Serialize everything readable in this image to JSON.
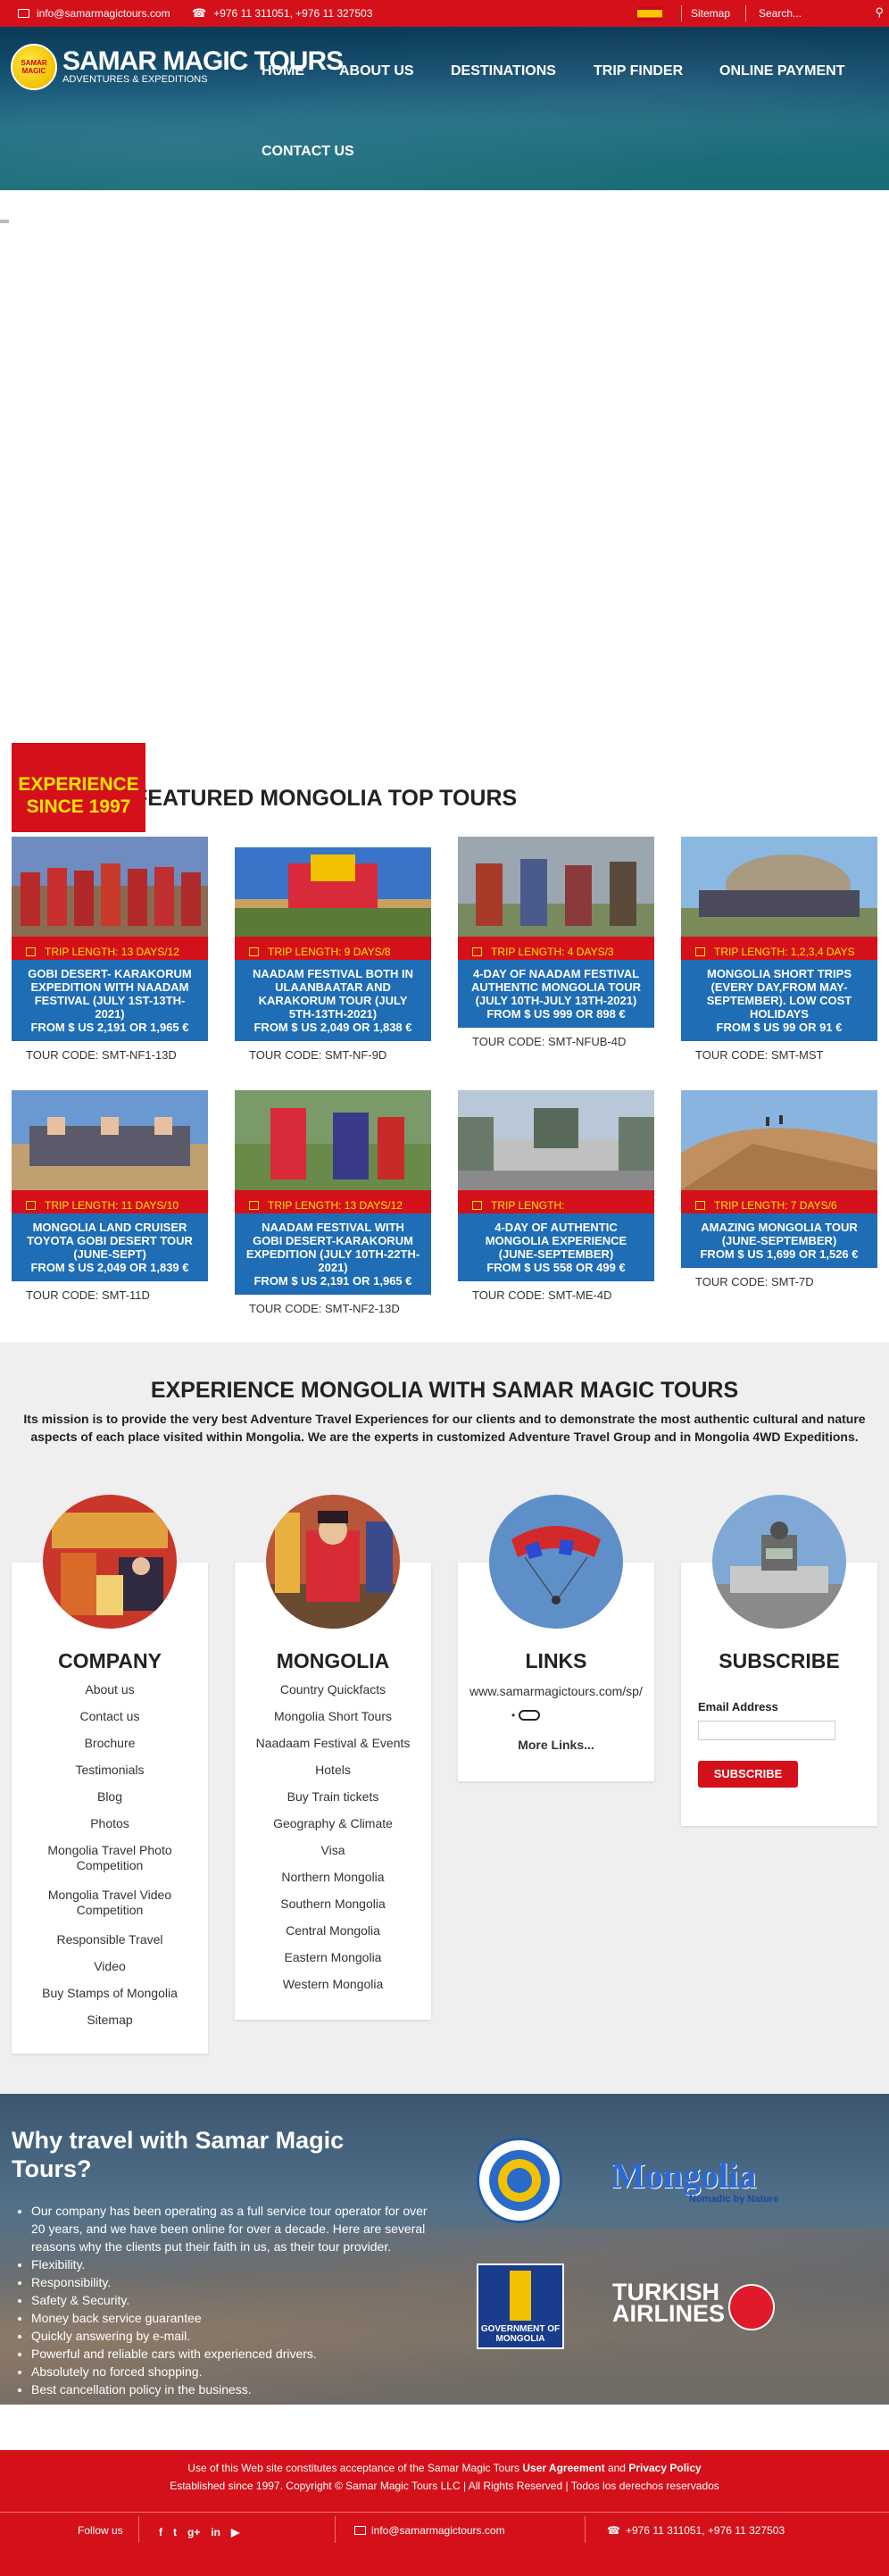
{
  "topbar": {
    "email": "info@samarmagictours.com",
    "phone": "+976 11 311051, +976 11 327503",
    "sitemap": "Sitemap",
    "search_placeholder": "Search..."
  },
  "logo": {
    "title": "SAMAR MAGIC TOURS",
    "subtitle": "ADVENTURES & EXPEDITIONS",
    "badge": "SAMAR MAGIC"
  },
  "nav": {
    "home": "HOME",
    "about": "ABOUT US",
    "destinations": "DESTINATIONS",
    "trip_finder": "TRIP FINDER",
    "payment": "ONLINE PAYMENT",
    "contact": "CONTACT US"
  },
  "badge": {
    "line1": "EXPERIENCE",
    "line2": "SINCE 1997"
  },
  "featured": {
    "title": "FEATURED MONGOLIA TOP TOURS"
  },
  "tours": [
    {
      "length": "TRIP LENGTH: 13 DAYS/12",
      "name": "GOBI DESERT- KARAKORUM EXPEDITION WITH NAADAM FESTIVAL (JULY 1ST-13TH-2021)",
      "price": "FROM $ US 2,191 OR 1,965 €",
      "code": "TOUR CODE: SMT-NF1-13D"
    },
    {
      "length": "TRIP LENGTH: 9 DAYS/8",
      "name": "NAADAM FESTIVAL BOTH IN ULAANBAATAR AND KARAKORUM TOUR (JULY 5TH-13TH-2021)",
      "price": "FROM $ US 2,049 OR 1,838 €",
      "code": "TOUR CODE: SMT-NF-9D"
    },
    {
      "length": "TRIP LENGTH: 4 DAYS/3",
      "name": "4-DAY OF NAADAM FESTIVAL AUTHENTIC MONGOLIA TOUR (JULY 10TH-JULY 13TH-2021)",
      "price": "FROM $ US 999 OR 898 €",
      "code": "TOUR CODE: SMT-NFUB-4D"
    },
    {
      "length": "TRIP LENGTH: 1,2,3,4 DAYS",
      "name": "MONGOLIA SHORT TRIPS (EVERY DAY,FROM MAY-SEPTEMBER). LOW COST HOLIDAYS",
      "price": "FROM $ US 99 OR 91 €",
      "code": "TOUR CODE: SMT-MST"
    },
    {
      "length": "TRIP LENGTH: 11 DAYS/10",
      "name": "MONGOLIA LAND CRUISER TOYOTA GOBI DESERT TOUR (JUNE-SEPT)",
      "price": "FROM $ US 2,049 OR 1,839 €",
      "code": "TOUR CODE: SMT-11D"
    },
    {
      "length": "TRIP LENGTH: 13 DAYS/12",
      "name": "NAADAM FESTIVAL WITH GOBI DESERT-KARAKORUM EXPEDITION (JULY 10TH-22TH-2021)",
      "price": "FROM $ US 2,191 OR 1,965 €",
      "code": "TOUR CODE: SMT-NF2-13D"
    },
    {
      "length": "TRIP LENGTH:",
      "name": "4-DAY OF AUTHENTIC MONGOLIA EXPERIENCE (JUNE-SEPTEMBER)",
      "price": "FROM $ US 558 OR 499 €",
      "code": "TOUR CODE: SMT-ME-4D"
    },
    {
      "length": "TRIP LENGTH: 7 DAYS/6",
      "name": "AMAZING MONGOLIA TOUR (JUNE-SEPTEMBER)",
      "price": "FROM $ US 1,699 OR 1,526 €",
      "code": "TOUR CODE: SMT-7D"
    }
  ],
  "about": {
    "title": "EXPERIENCE MONGOLIA WITH SAMAR MAGIC TOURS",
    "text": "Its mission is to provide the very best Adventure Travel Experiences for our clients and to demonstrate the most authentic cultural and nature aspects of each place visited within Mongolia. We are the experts in customized Adventure Travel Group and in Mongolia 4WD Expeditions."
  },
  "company": {
    "title": "COMPANY",
    "links": [
      "About us",
      "Contact us",
      "Brochure",
      "Testimonials",
      "Blog",
      "Photos",
      "Mongolia Travel Photo Competition",
      "Mongolia Travel Video Competition",
      "Responsible Travel",
      "Video",
      "Buy Stamps of Mongolia",
      "Sitemap"
    ]
  },
  "mongolia": {
    "title": "MONGOLIA",
    "links": [
      "Country Quickfacts",
      "Mongolia Short Tours",
      "Naadaam Festival & Events",
      "Hotels",
      "Buy Train tickets",
      "Geography & Climate",
      "Visa",
      "Northern Mongolia",
      "Southern Mongolia",
      "Central Mongolia",
      "Eastern Mongolia",
      "Western Mongolia"
    ]
  },
  "links": {
    "title": "LINKS",
    "url": "www.samarmagictours.com/sp/",
    "more": "More Links..."
  },
  "subscribe": {
    "title": "SUBSCRIBE",
    "email_label": "Email Address",
    "button": "SUBSCRIBE"
  },
  "why": {
    "title": "Why travel with Samar Magic Tours?",
    "items": [
      "Our company has been operating as a full service tour operator for over 20 years, and we have been online for over a decade. Here are several reasons why the clients put their faith in us, as their tour provider.",
      "Flexibility.",
      "Responsibility.",
      "Safety & Security.",
      "Money back service guarantee",
      "Quickly answering by e-mail.",
      "Powerful and reliable cars with experienced drivers.",
      "Absolutely no forced shopping.",
      "Best cancellation policy in the business."
    ],
    "logo_mongolia": "Mongolia",
    "logo_mongolia_sub": "Nomadic by Nature",
    "logo_gov": "GOVERNMENT OF MONGOLIA",
    "logo_turkish": "TURKISH AIRLINES"
  },
  "footer": {
    "terms_prefix": "Use of this Web site constitutes acceptance of the Samar Magic Tours ",
    "terms_link1": "User Agreement",
    "terms_and": " and ",
    "terms_link2": "Privacy Policy",
    "copyright": "Established since 1997. Copyright © Samar Magic Tours LLC | All Rights Reserved | Todos los derechos reservados",
    "follow": "Follow us",
    "social": [
      "f",
      "t",
      "g+",
      "in",
      "▶"
    ],
    "email": "info@samarmagictours.com",
    "phone": "+976 11 311051, +976 11 327503"
  },
  "colors": {
    "red": "#d4111a",
    "yellow": "#ffe400",
    "blue": "#1e6db5"
  }
}
